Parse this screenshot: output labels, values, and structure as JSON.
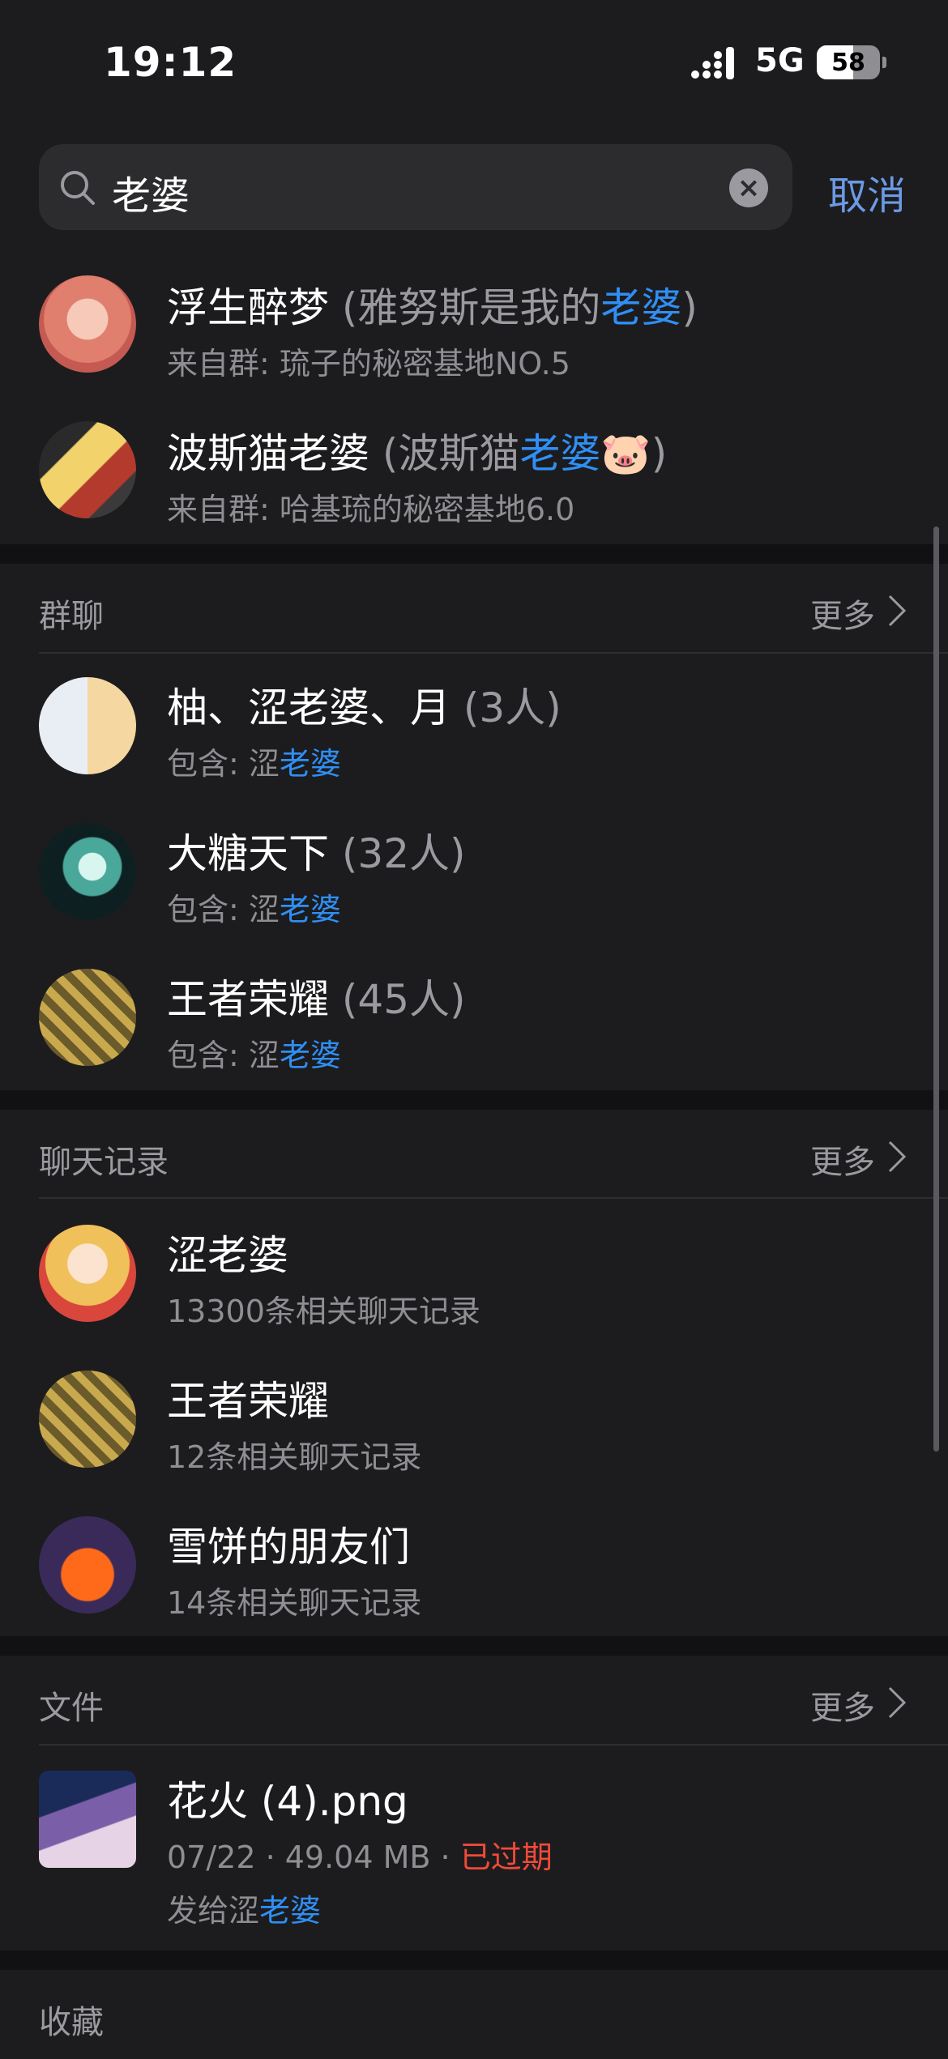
{
  "status": {
    "time": "19:12",
    "network": "5G",
    "battery": "58",
    "battery_fraction": 0.58
  },
  "search": {
    "query": "老婆",
    "cancel": "取消"
  },
  "contacts": [
    {
      "name": "浮生醉梦",
      "paren_open": "(",
      "alias_plain": "雅努斯是我的",
      "alias_highlight": "老婆",
      "alias_emoji": "",
      "paren_close": ")",
      "subtitle": "来自群: 琉子的秘密基地NO.5"
    },
    {
      "name": "波斯猫老婆",
      "paren_open": "(",
      "alias_plain": "波斯猫",
      "alias_highlight": "老婆",
      "alias_emoji": "🐷",
      "paren_close": ")",
      "subtitle": "来自群: 哈基琉的秘密基地6.0"
    }
  ],
  "groups": {
    "header": "群聊",
    "more": "更多",
    "items": [
      {
        "name": "柚、涩老婆、月",
        "count": "(3人)",
        "contains_label": "包含: 涩",
        "contains_highlight": "老婆"
      },
      {
        "name": "大糖天下",
        "count": "(32人)",
        "contains_label": "包含: 涩",
        "contains_highlight": "老婆"
      },
      {
        "name": "王者荣耀",
        "count": "(45人)",
        "contains_label": "包含: 涩",
        "contains_highlight": "老婆"
      }
    ]
  },
  "chats": {
    "header": "聊天记录",
    "more": "更多",
    "items": [
      {
        "name": "涩老婆",
        "records": "13300条相关聊天记录"
      },
      {
        "name": "王者荣耀",
        "records": "12条相关聊天记录"
      },
      {
        "name": "雪饼的朋友们",
        "records": "14条相关聊天记录"
      }
    ]
  },
  "files": {
    "header": "文件",
    "more": "更多",
    "items": [
      {
        "name": "花火 (4).png",
        "meta": "07/22 · 49.04 MB · ",
        "status": "已过期",
        "sent_to_label": "发给涩",
        "sent_to_highlight": "老婆"
      }
    ]
  },
  "favorites": {
    "header": "收藏"
  },
  "colors": {
    "background": "#1c1c1e",
    "highlight": "#2f8ff5",
    "expired": "#f04a3a",
    "cancel": "#6c9ae6"
  }
}
